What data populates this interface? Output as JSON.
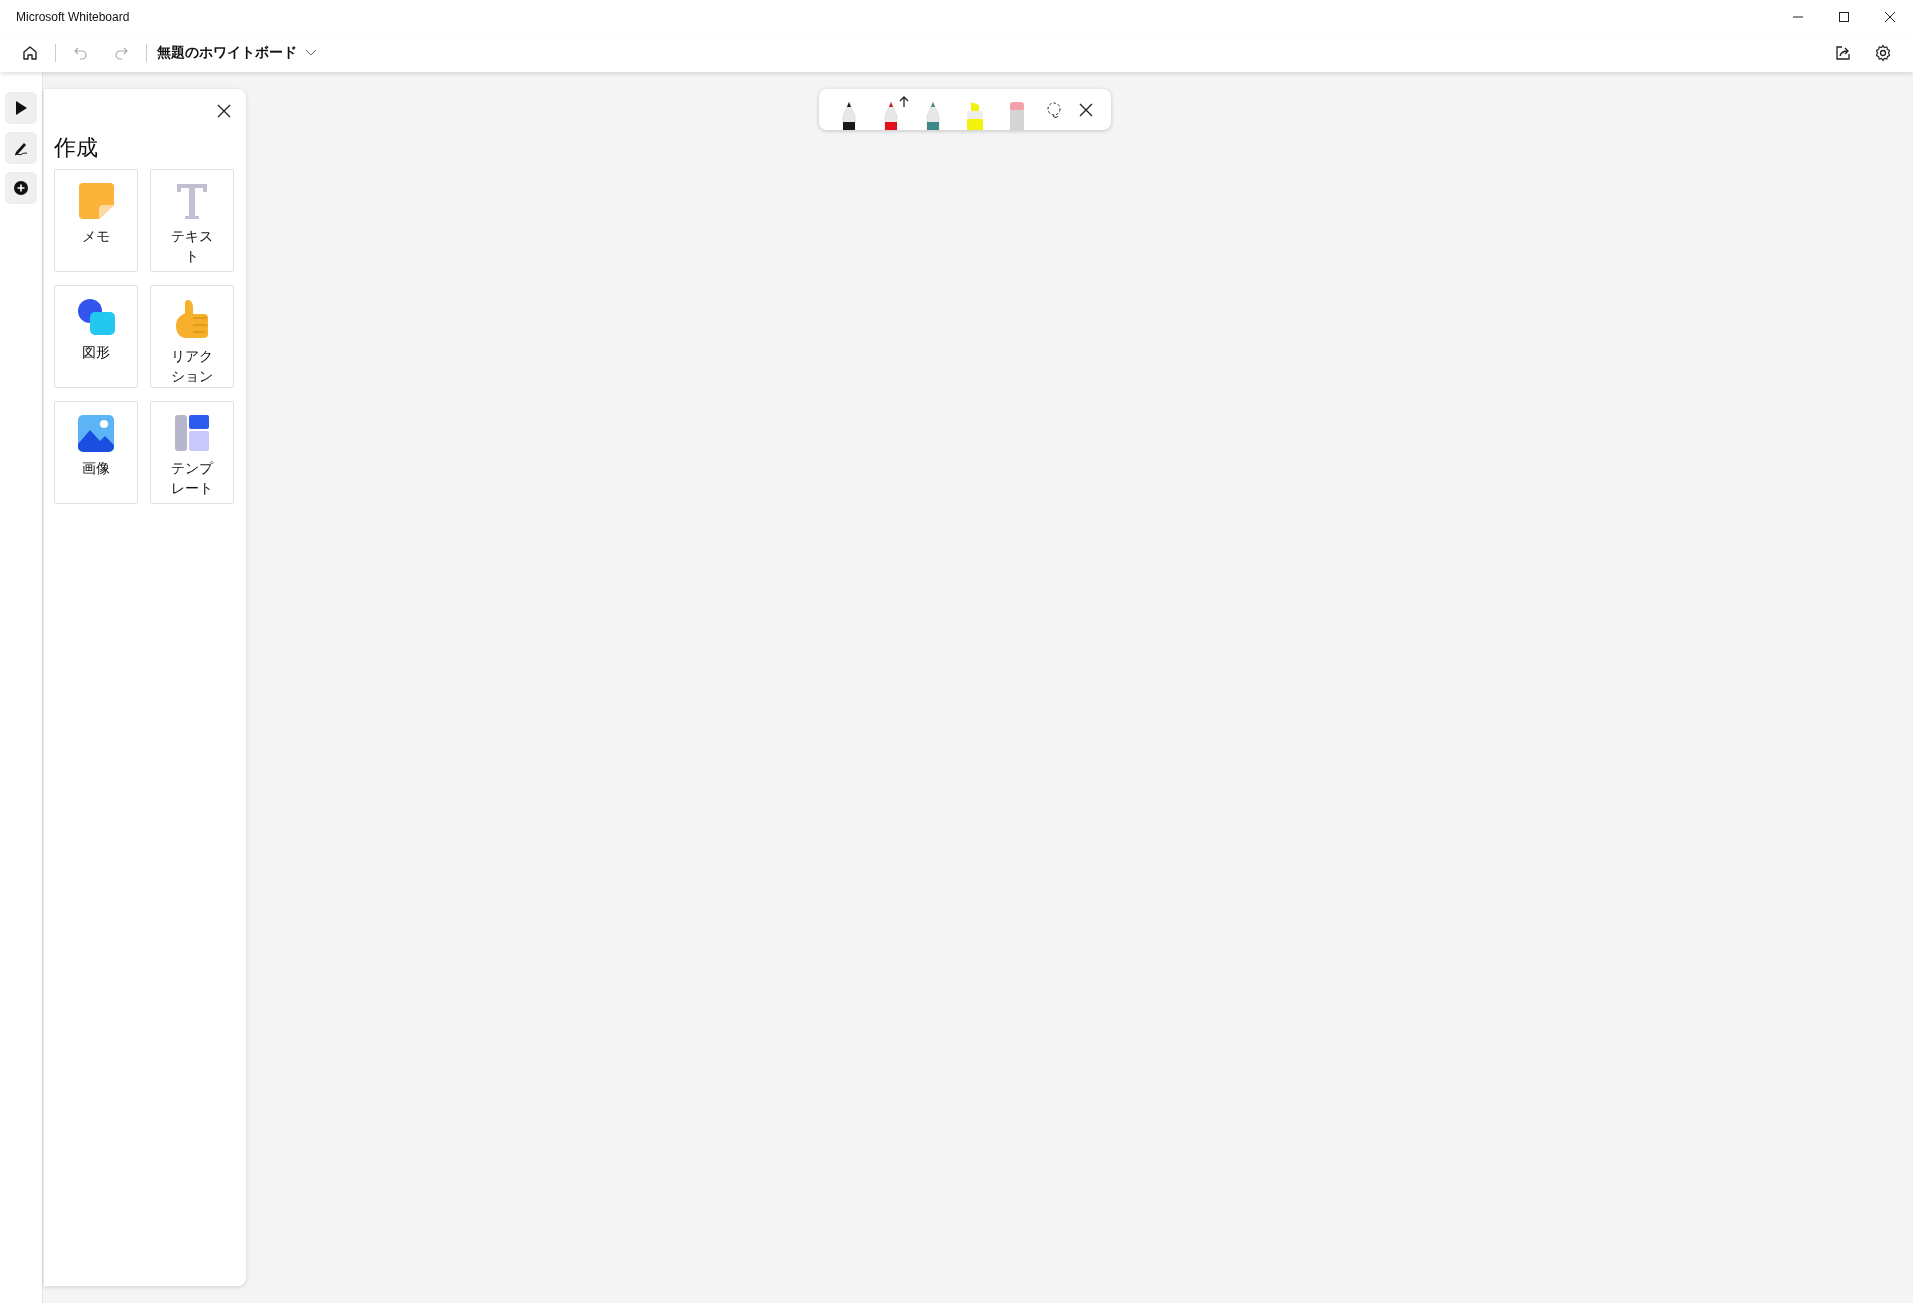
{
  "window": {
    "title": "Microsoft Whiteboard"
  },
  "board": {
    "title": "無題のホワイトボード"
  },
  "rail": [
    {
      "kind": "select"
    },
    {
      "kind": "ink"
    },
    {
      "kind": "add"
    }
  ],
  "create_panel": {
    "title": "作成",
    "tiles": [
      {
        "kind": "note",
        "label": "メモ"
      },
      {
        "kind": "text",
        "label": "テキスト"
      },
      {
        "kind": "shape",
        "label": "図形"
      },
      {
        "kind": "reaction",
        "label": "リアクション"
      },
      {
        "kind": "image",
        "label": "画像"
      },
      {
        "kind": "template",
        "label": "テンプレート"
      }
    ]
  },
  "ink_tray": {
    "tools": [
      {
        "kind": "pen",
        "color": "#1a1a1a",
        "arrow_tip": false
      },
      {
        "kind": "pen",
        "color": "#e0101e",
        "arrow_tip": true
      },
      {
        "kind": "pen",
        "color": "#3a8a8a",
        "arrow_tip": false
      },
      {
        "kind": "highlighter",
        "color": "#f2f20c",
        "arrow_tip": false
      },
      {
        "kind": "eraser",
        "color": "#f4a0a8",
        "arrow_tip": false
      }
    ]
  }
}
